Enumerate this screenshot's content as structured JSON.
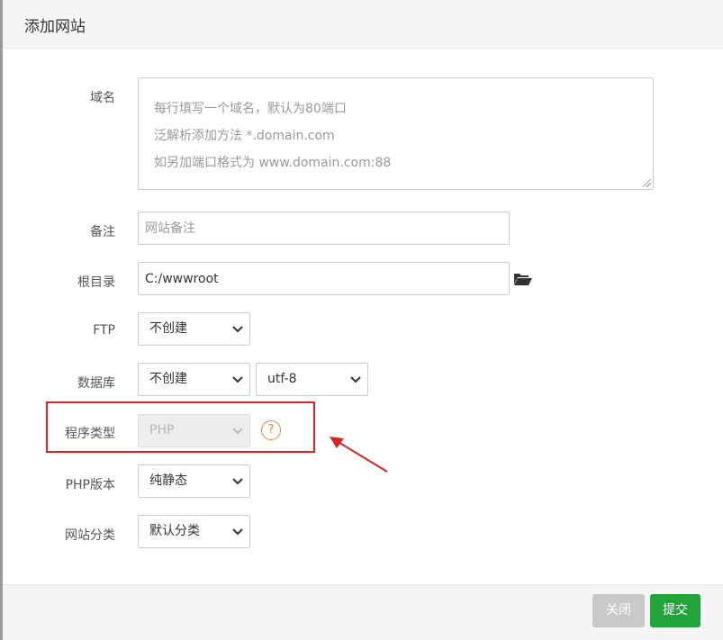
{
  "dialog": {
    "title": "添加网站"
  },
  "form": {
    "domain": {
      "label": "域名",
      "placeholder_lines": [
        "每行填写一个域名，默认为80端口",
        "泛解析添加方法 *.domain.com",
        "如另加端口格式为 www.domain.com:88"
      ]
    },
    "remark": {
      "label": "备注",
      "placeholder": "网站备注"
    },
    "root": {
      "label": "根目录",
      "value": "C:/wwwroot",
      "icon": "folder-open-icon"
    },
    "ftp": {
      "label": "FTP",
      "selected": "不创建"
    },
    "database": {
      "label": "数据库",
      "selected": "不创建",
      "charset_selected": "utf-8"
    },
    "program_type": {
      "label": "程序类型",
      "selected": "PHP",
      "help_icon": "?"
    },
    "php_version": {
      "label": "PHP版本",
      "selected": "纯静态"
    },
    "category": {
      "label": "网站分类",
      "selected": "默认分类"
    }
  },
  "footer": {
    "close_label": "关闭",
    "submit_label": "提交"
  },
  "colors": {
    "submit": "#20a53a",
    "close": "#c9c9c9",
    "highlight": "#e02020",
    "help": "#e8872e"
  }
}
